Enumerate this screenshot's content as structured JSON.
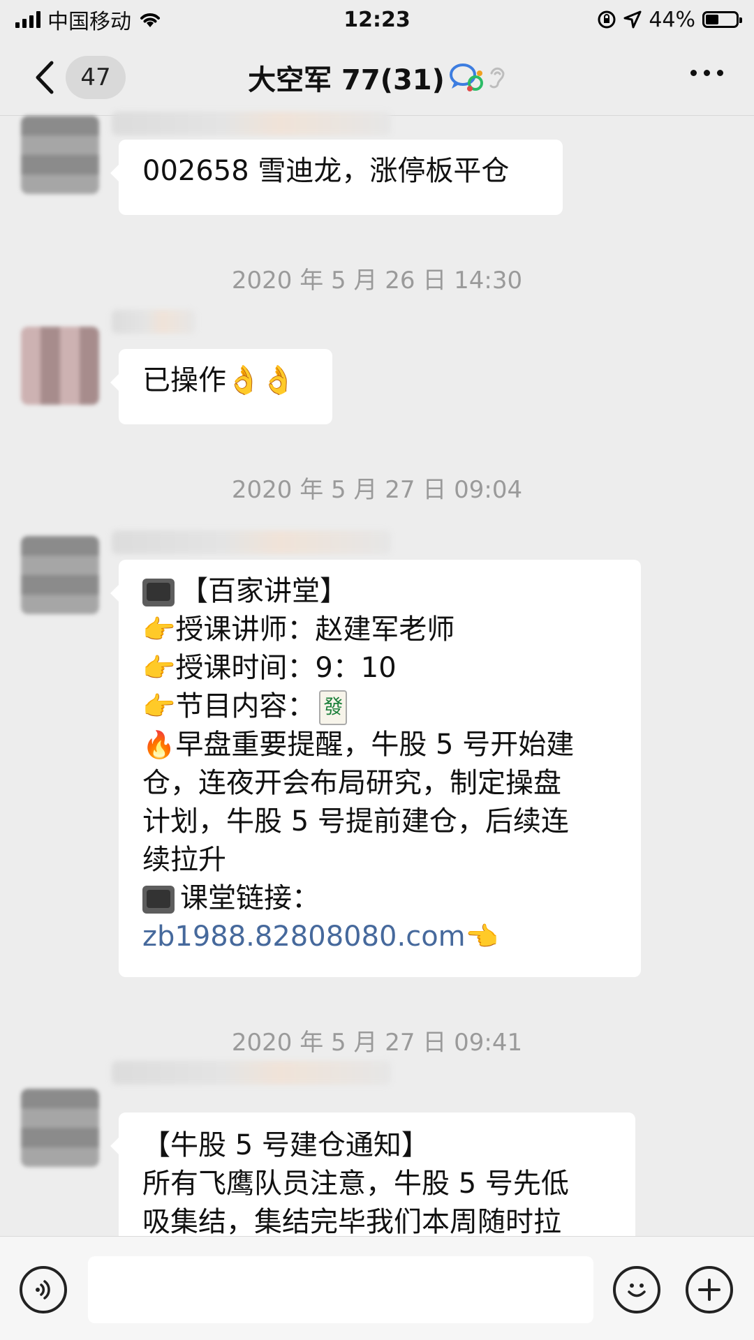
{
  "status_bar": {
    "carrier": "中国移动",
    "time": "12:23",
    "battery": "44%",
    "battery_level": 0.44
  },
  "nav": {
    "unread_count": "47",
    "title": "大空军 77(31)",
    "icons": [
      "chevron-left-icon",
      "chat-bubbles-icon",
      "ear-icon",
      "more-dots-icon"
    ]
  },
  "messages": [
    {
      "type": "message",
      "text_lines": [
        "002658 雪迪龙，涨停板平仓"
      ]
    },
    {
      "type": "timestamp",
      "text": "2020 年 5 月 26 日 14:30"
    },
    {
      "type": "message",
      "text_lines": [
        "已操作👌👌"
      ]
    },
    {
      "type": "timestamp",
      "text": "2020 年 5 月 27 日 09:04"
    },
    {
      "type": "message",
      "lines": {
        "l1": "【百家讲堂】",
        "l2": "授课讲师：赵建军老师",
        "l3": "授课时间：9：10",
        "l4": "节目内容：",
        "l4_tile": "發",
        "l5": "早盘重要提醒，牛股 5 号开始建",
        "l6": "仓，连夜开会布局研究，制定操盘",
        "l7": "计划，牛股 5 号提前建仓，后续连",
        "l8": "续拉升",
        "l9": "课堂链接：",
        "link": "zb1988.82808080.com"
      }
    },
    {
      "type": "timestamp",
      "text": "2020 年 5 月 27 日 09:41"
    },
    {
      "type": "message",
      "lines": {
        "l1": "【牛股 5 号建仓通知】",
        "l2": "所有飞鹰队员注意，牛股 5 号先低",
        "l3": "吸集结，集结完毕我们本周随时拉"
      }
    }
  ],
  "input_bar": {
    "placeholder": "",
    "icons": [
      "voice-icon",
      "emoji-icon",
      "plus-icon"
    ]
  }
}
